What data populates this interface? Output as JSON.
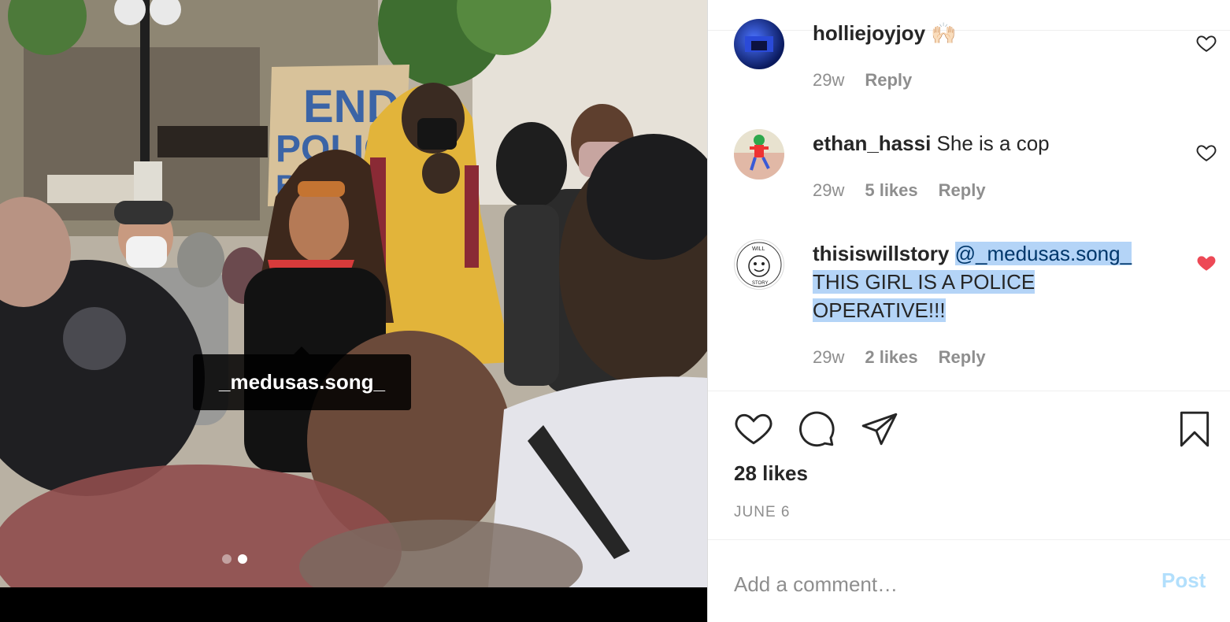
{
  "photo": {
    "tag_label": "_medusas.song_",
    "sign_text": "END POLICE BR",
    "carousel": {
      "count": 2,
      "active_index": 1
    }
  },
  "comments": [
    {
      "username": "holliejoyjoy",
      "emoji": "🙌🏻",
      "text": "",
      "time": "29w",
      "likes": "",
      "reply": "Reply",
      "liked": false
    },
    {
      "username": "ethan_hassi",
      "text": "She is a cop",
      "time": "29w",
      "likes": "5 likes",
      "reply": "Reply",
      "liked": false
    },
    {
      "username": "thisiswillstory",
      "mention": "@_medusas.song_",
      "text_line1": "THIS GIRL IS A POLICE",
      "text_line2": "OPERATIVE!!!",
      "time": "29w",
      "likes": "2 likes",
      "reply": "Reply",
      "liked": true
    }
  ],
  "post": {
    "likes": "28 likes",
    "date": "JUNE 6"
  },
  "comment_box": {
    "placeholder": "Add a comment…",
    "post_label": "Post"
  },
  "colors": {
    "heart_liked": "#ed4956",
    "text": "#262626",
    "meta": "#8e8e8e",
    "post_disabled": "#b2dffc",
    "selection": "#b4d4f7"
  },
  "icons": {
    "like": "heart-icon",
    "comment": "comment-icon",
    "share": "paper-plane-icon",
    "save": "bookmark-icon"
  }
}
